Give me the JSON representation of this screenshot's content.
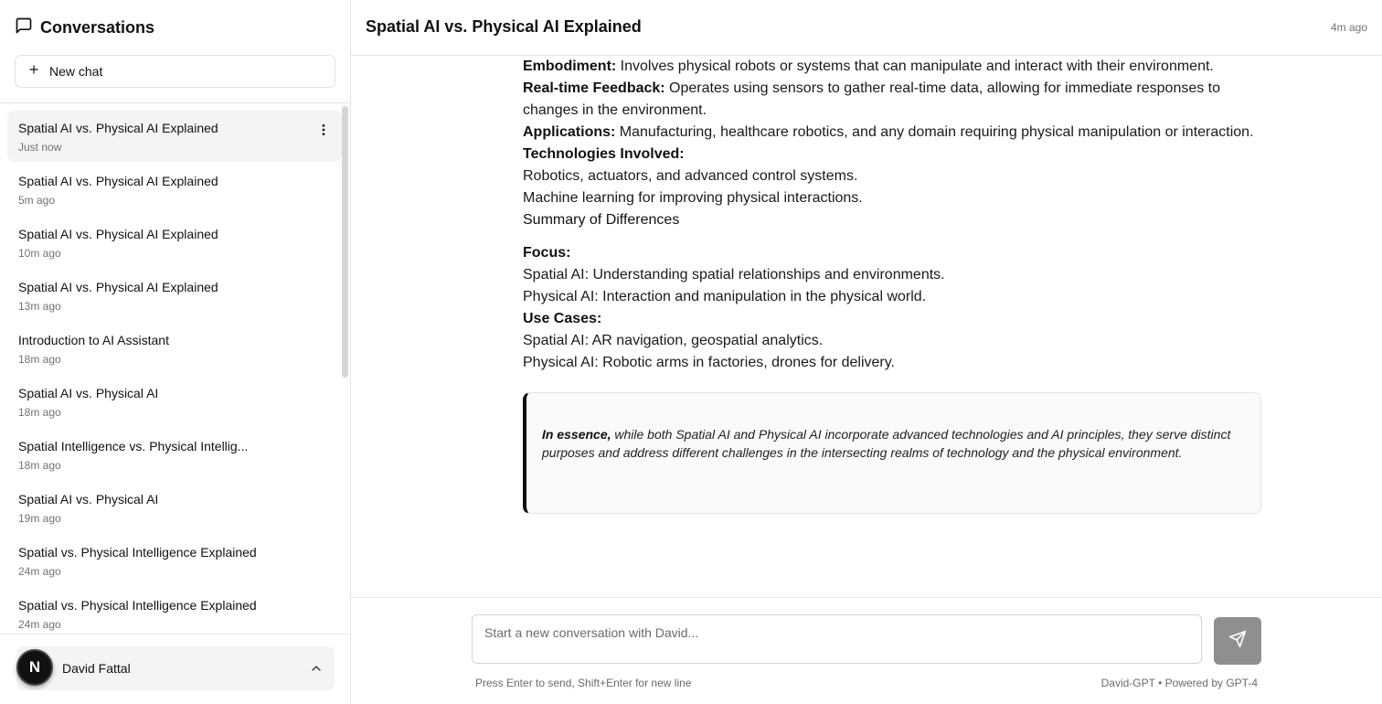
{
  "sidebar": {
    "title": "Conversations",
    "new_chat_label": "New chat",
    "conversations": [
      {
        "title": "Spatial AI vs. Physical AI Explained",
        "time": "Just now",
        "active": true
      },
      {
        "title": "Spatial AI vs. Physical AI Explained",
        "time": "5m ago"
      },
      {
        "title": "Spatial AI vs. Physical AI Explained",
        "time": "10m ago"
      },
      {
        "title": "Spatial AI vs. Physical AI Explained",
        "time": "13m ago"
      },
      {
        "title": "Introduction to AI Assistant",
        "time": "18m ago"
      },
      {
        "title": "Spatial AI vs. Physical AI",
        "time": "18m ago"
      },
      {
        "title": "Spatial Intelligence vs. Physical Intellig...",
        "time": "18m ago"
      },
      {
        "title": "Spatial AI vs. Physical AI",
        "time": "19m ago"
      },
      {
        "title": "Spatial vs. Physical Intelligence Explained",
        "time": "24m ago"
      },
      {
        "title": "Spatial vs. Physical Intelligence Explained",
        "time": "24m ago"
      }
    ],
    "user": {
      "name": "David Fattal",
      "avatar_letter": "N"
    }
  },
  "header": {
    "title": "Spatial AI vs. Physical AI Explained",
    "time": "4m ago"
  },
  "message": {
    "embodiment_label": "Embodiment:",
    "embodiment_text": " Involves physical robots or systems that can manipulate and interact with their environment.",
    "realtime_label": "Real-time Feedback:",
    "realtime_text": " Operates using sensors to gather real-time data, allowing for immediate responses to changes in the environment.",
    "applications_label": "Applications:",
    "applications_text": " Manufacturing, healthcare robotics, and any domain requiring physical manipulation or interaction.",
    "technologies_label": "Technologies Involved:",
    "technologies_1": "Robotics, actuators, and advanced control systems.",
    "technologies_2": "Machine learning for improving physical interactions.",
    "summary_heading": "Summary of Differences",
    "focus_label": "Focus:",
    "focus_spatial": "Spatial AI: Understanding spatial relationships and environments.",
    "focus_physical": "Physical AI: Interaction and manipulation in the physical world.",
    "usecases_label": "Use Cases:",
    "usecases_spatial": "Spatial AI: AR navigation, geospatial analytics.",
    "usecases_physical": "Physical AI: Robotic arms in factories, drones for delivery.",
    "quote_bold": "In essence,",
    "quote_text": " while both Spatial AI and Physical AI incorporate advanced technologies and AI principles, they serve distinct purposes and address different challenges in the intersecting realms of technology and the physical environment."
  },
  "composer": {
    "placeholder": "Start a new conversation with David...",
    "hint": "Press Enter to send, Shift+Enter for new line",
    "powered": "David-GPT • Powered by GPT-4"
  },
  "icons": {
    "sidebar_title": "message-square-icon",
    "new_chat": "plus-icon",
    "conversation_menu": "more-vertical-icon",
    "user_menu": "chevron-up-icon",
    "send": "send-icon"
  },
  "colors": {
    "active_conversation_bg": "#f4f4f5",
    "send_button_bg": "#8f8f8f",
    "quote_border": "#111111"
  }
}
